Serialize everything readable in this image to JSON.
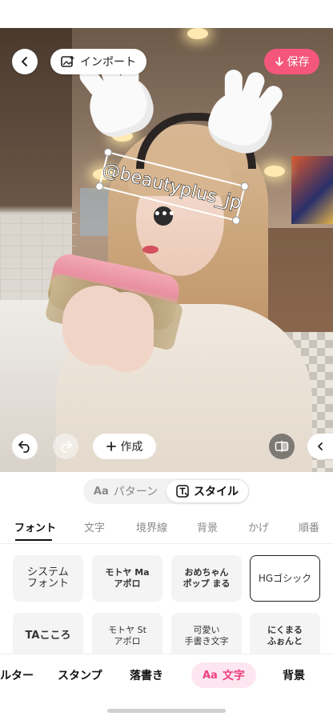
{
  "topbar": {
    "import_label": "インポート",
    "save_label": "保存",
    "save_color": "#f4577b"
  },
  "sticker": {
    "text": "@beautyplus_jp",
    "more_glyph": "•••"
  },
  "controls": {
    "create_label": "作成"
  },
  "mode_switch": {
    "items": [
      {
        "label": "パターン",
        "icon": "pattern-aa-icon",
        "active": false
      },
      {
        "label": "スタイル",
        "icon": "style-text-icon",
        "active": true
      }
    ]
  },
  "tabs": [
    "フォント",
    "文字",
    "境界線",
    "背景",
    "かげ",
    "順番"
  ],
  "active_tab": "フォント",
  "fonts": [
    {
      "label": "システム\nフォント"
    },
    {
      "label": "モトヤ Ma\nアポロ"
    },
    {
      "label": "おめちゃん\nポップ まる"
    },
    {
      "label": "HGゴシック",
      "selected": true
    },
    {
      "label": "TAこころ"
    },
    {
      "label": "モトヤ St\nアポロ"
    },
    {
      "label": "可愛い\n手書き文字"
    },
    {
      "label": "にくまる\nふぉんと"
    }
  ],
  "bottom_nav": {
    "items": [
      {
        "label": "ルター"
      },
      {
        "label": "スタンプ"
      },
      {
        "label": "落書き"
      },
      {
        "label": "文字",
        "icon": "aa-icon",
        "active": true,
        "active_color": "#ef3f7d"
      },
      {
        "label": "背景"
      }
    ]
  }
}
